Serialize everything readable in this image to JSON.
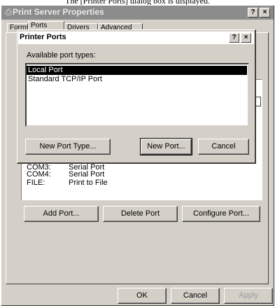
{
  "caption": "The [Printer Ports] dialog box is displayed.",
  "window": {
    "title": "Print Server Properties",
    "help_glyph": "?",
    "close_glyph": "×",
    "tabs": [
      "Forms",
      "Ports",
      "Drivers",
      "Advanced"
    ]
  },
  "ports_list": [
    {
      "port": "COM3:",
      "description": "Serial Port"
    },
    {
      "port": "COM4:",
      "description": "Serial Port"
    },
    {
      "port": "FILE:",
      "description": "Print to File"
    }
  ],
  "buttons": {
    "add_port": "Add Port...",
    "delete_port": "Delete Port",
    "configure_port": "Configure Port...",
    "ok": "OK",
    "cancel": "Cancel",
    "apply": "Apply"
  },
  "dialog": {
    "title": "Printer Ports",
    "help_glyph": "?",
    "close_glyph": "×",
    "available_label": "Available port types:",
    "port_types": [
      "Local Port",
      "Standard TCP/IP Port"
    ],
    "selected_index": 0,
    "new_port_type": "New Port Type...",
    "new_port": "New Port...",
    "cancel": "Cancel"
  }
}
